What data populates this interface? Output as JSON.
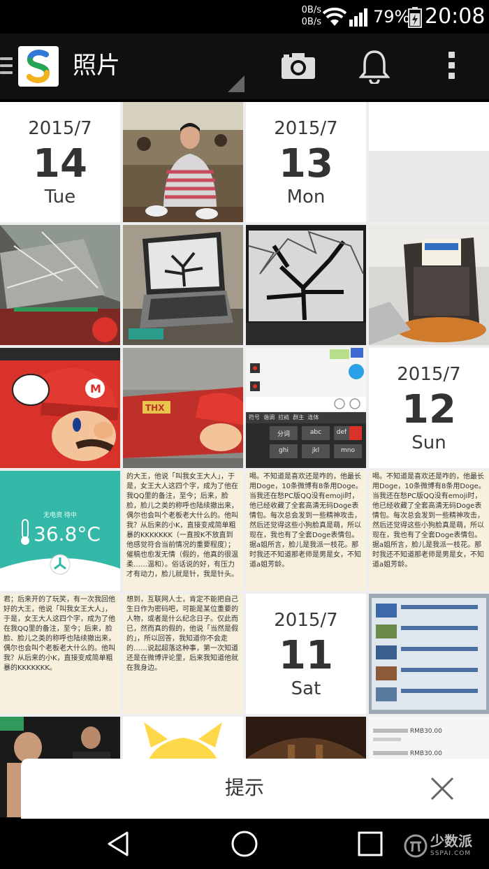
{
  "status_bar": {
    "net_up": "0B/s",
    "net_down": "0B/s",
    "battery_pct": "79%",
    "time": "20:08"
  },
  "app_bar": {
    "title": "照片",
    "icons": [
      "menu-icon",
      "app-logo",
      "camera-icon",
      "bell-icon",
      "overflow-icon"
    ]
  },
  "dates": [
    {
      "ym": "2015/7",
      "day": "14",
      "weekday": "Tue"
    },
    {
      "ym": "2015/7",
      "day": "13",
      "weekday": "Mon"
    },
    {
      "ym": "2015/7",
      "day": "12",
      "weekday": "Sun"
    },
    {
      "ym": "2015/7",
      "day": "11",
      "weekday": "Sat"
    }
  ],
  "thermo": {
    "reading": "36.8°C",
    "label": "无电资 待中"
  },
  "keyboard": {
    "rows": [
      "符号",
      "谐调",
      "拉裢",
      "群主",
      "连体"
    ],
    "keys": [
      "分词",
      "abc",
      "def",
      "ghi",
      "jkl",
      "mno"
    ]
  },
  "text_pages": [
    "的大王，他说「叫我女王大人」，于是，女王大人这四个字，成为了他在我QQ里的备注，至今；后来，脸脸，脸儿之类的称呼也陆续撤出来，偶尔也会叫个老板老大什么的。他叫我？从后来的小K，直接变成简单粗暴的KKKKKKK（一直按K不放直到他感觉符合当前情况的重要程度）；催稿也愈发无情（假的，他真的很温柔……温和）。俗话说的好，有压力才有动力，脸儿就是针，我是针头。",
    "喝。不知道是喜欢还是咋的，他最长用Doge，10条微博有8条用Doge。当我还在愁PC版QQ没有emoji时，他已经收藏了全套高清无码Doge表情包。每次总会发到一些精神攻击，然后还觉得这些小狗脸真是萌，所以现在，我也有了全套Doge表情包。据a姐所言，脸儿是我派一枝花。那时我还不知道那老师是男是女，不知道a姐芳龄。",
    "君；后来开的了玩笑，有一次我回他好的大王，他说「叫我女王大人」，于是，女王大人这四个字，成为了他在我QQ里的备注，至今；后来，脸脸、脸儿之类的称呼也陆续撤出来，偶尔也会叫个老板老大什么的。他叫我？从后来的小K，直接变成简单粗暴的KKKKKKK。",
    "想到，互联网人士，肯定不能把自己生日作为密码吧，可能是某位重要的人物，或者是什么纪念日子。仅此而已，然而真的假的，他说「当然是假的」，所以回答，我知道你不会走的……说起超落这种事，第一次知道还是在微博评论里，后来我知道他就在我身边。"
  ],
  "listing": {
    "price_1": "RMB30.00",
    "price_2": "RMB30.00"
  },
  "hint": {
    "text": "提示"
  },
  "nav": [
    "back-icon",
    "home-icon",
    "recent-apps-icon"
  ],
  "watermark": {
    "text": "少数派",
    "sub": "SSPAI.COM"
  },
  "colors": {
    "mario_red": "#d8322a",
    "thermo_teal": "#34b8a8",
    "toast_bg": "#ffffff"
  }
}
